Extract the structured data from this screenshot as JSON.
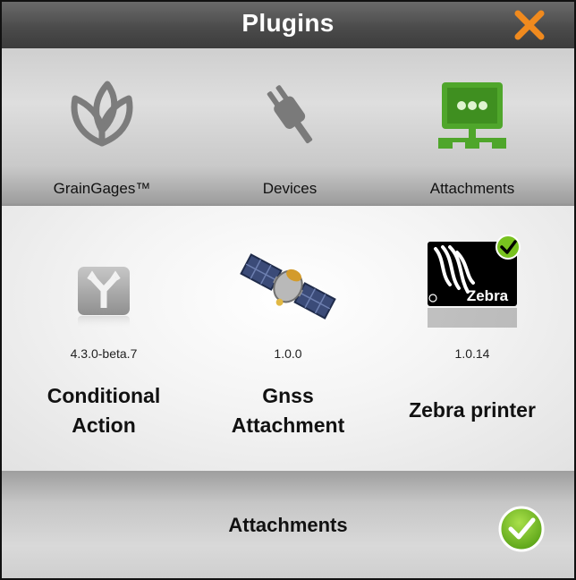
{
  "window": {
    "title": "Plugins"
  },
  "tabs": [
    {
      "label": "GrainGages™",
      "icon": "leaf-icon"
    },
    {
      "label": "Devices",
      "icon": "plug-icon"
    },
    {
      "label": "Attachments",
      "icon": "attachments-network-icon"
    }
  ],
  "plugins": [
    {
      "version": "4.3.0-beta.7",
      "name_line1": "Conditional",
      "name_line2": "Action",
      "icon": "branch-icon"
    },
    {
      "version": "1.0.0",
      "name_line1": "Gnss",
      "name_line2": "Attachment",
      "icon": "satellite-icon"
    },
    {
      "version": "1.0.14",
      "name_line1": "Zebra printer",
      "icon": "zebra-logo-icon",
      "logo_text": "Zebra",
      "installed": true
    }
  ],
  "footer": {
    "title": "Attachments"
  },
  "colors": {
    "accent_green": "#4fa62b",
    "close_orange": "#f08a1e",
    "confirm_green": "#7bc72a"
  }
}
